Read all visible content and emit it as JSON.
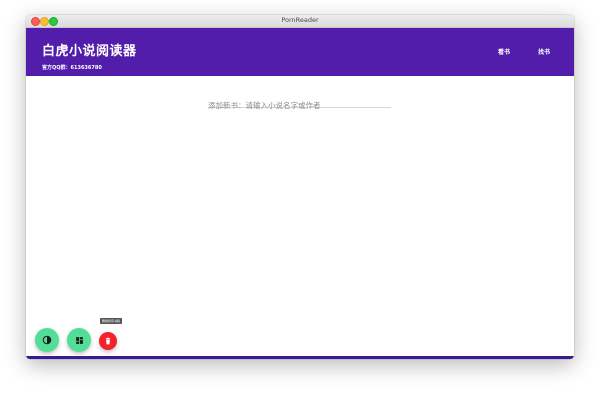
{
  "window": {
    "title": "PornReader"
  },
  "header": {
    "title": "白虎小说阅读器",
    "subtitle": "官方QQ群：613636780",
    "nav": [
      {
        "label": "看书"
      },
      {
        "label": "找书"
      }
    ]
  },
  "search": {
    "value": "",
    "placeholder": "添加新书：请输入小说名字或作者"
  },
  "fabs": {
    "theme_icon": "contrast-icon",
    "layout_icon": "dashboard-icon",
    "delete_icon": "trash-icon",
    "delete_tooltip": "删除所有书籍"
  },
  "colors": {
    "appbar": "#531dab",
    "fab_green": "#52de97",
    "fab_red": "#f5222d"
  }
}
